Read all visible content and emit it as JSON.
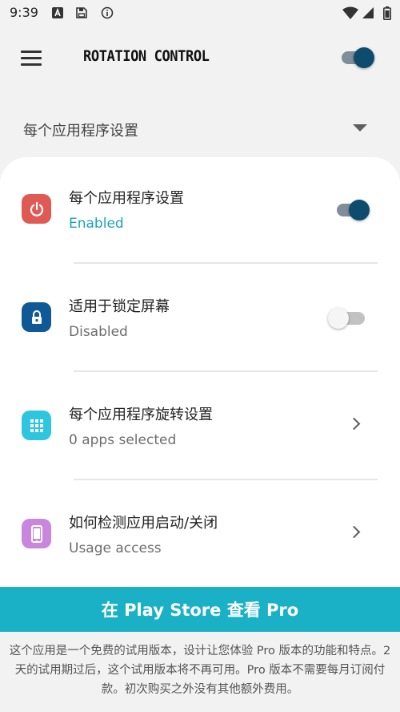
{
  "status_bar": {
    "time": "9:39",
    "icons": [
      "font-a-icon",
      "save-icon",
      "info-icon",
      "wifi-icon",
      "signal-icon",
      "battery-icon"
    ]
  },
  "app_bar": {
    "menu_icon": "hamburger-menu-icon",
    "title": "ROTATION CONTROL",
    "master_toggle": "on"
  },
  "section": {
    "title": "每个应用程序设置",
    "dropdown_icon": "dropdown-arrow-icon"
  },
  "settings": [
    {
      "title": "每个应用程序设置",
      "subtitle": "Enabled",
      "icon": "power-icon",
      "icon_color": "#e05a55",
      "control": "toggle",
      "state": "on"
    },
    {
      "title": "适用于锁定屏幕",
      "subtitle": "Disabled",
      "icon": "lock-icon",
      "icon_color": "#0f5a96",
      "control": "toggle",
      "state": "off"
    },
    {
      "title": "每个应用程序旋转设置",
      "subtitle": "0 apps selected",
      "icon": "apps-grid-icon",
      "icon_color": "#2ec5df",
      "control": "chevron"
    },
    {
      "title": "如何检测应用启动/关闭",
      "subtitle": "Usage access",
      "icon": "phone-icon",
      "icon_color": "#c886dc",
      "control": "chevron"
    }
  ],
  "pro_button": {
    "label": "在 Play Store 查看 Pro"
  },
  "footer": {
    "text": "这个应用是一个免费的试用版本，设计让您体验 Pro 版本的功能和特点。2天的试用期过后，这个试用版本将不再可用。Pro 版本不需要每月订阅付款。初次购买之外没有其他额外费用。"
  },
  "colors": {
    "accent": "#1ab0c5",
    "toggle_on": "#0e4c6e",
    "enabled_text": "#1aa3b8"
  }
}
